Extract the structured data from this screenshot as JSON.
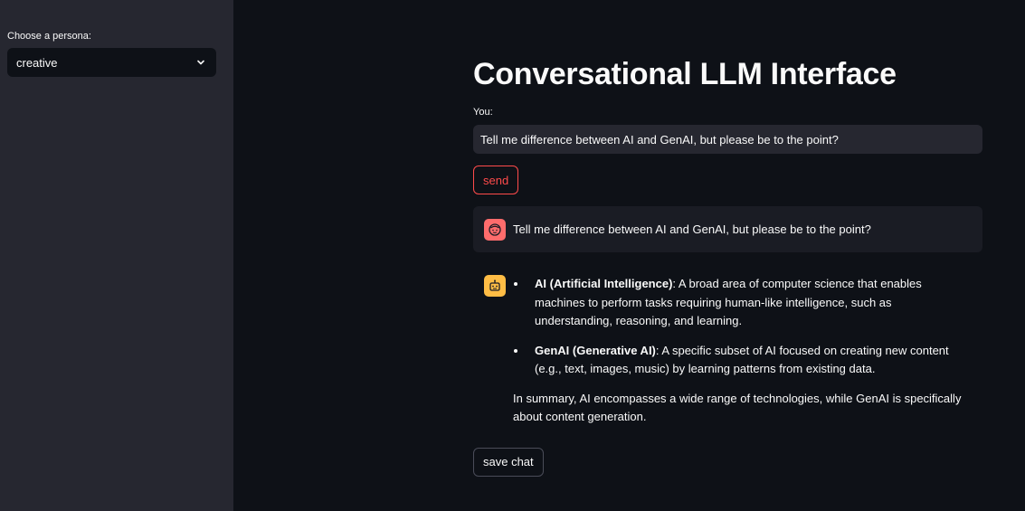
{
  "sidebar": {
    "persona_label": "Choose a persona:",
    "persona_selected": "creative"
  },
  "main": {
    "title": "Conversational LLM Interface",
    "input_label": "You:",
    "input_value": "Tell me difference between AI and GenAI, but please be to the point?",
    "send_label": "send",
    "save_label": "save chat"
  },
  "chat": {
    "user_message": "Tell me difference between AI and GenAI, but please be to the point?",
    "bot": {
      "bullets": [
        {
          "term": "AI (Artificial Intelligence)",
          "text": ": A broad area of computer science that enables machines to perform tasks requiring human-like intelligence, such as understanding, reasoning, and learning."
        },
        {
          "term": "GenAI (Generative AI)",
          "text": ": A specific subset of AI focused on creating new content (e.g., text, images, music) by learning patterns from existing data."
        }
      ],
      "summary": "In summary, AI encompasses a wide range of technologies, while GenAI is specifically about content generation."
    }
  },
  "colors": {
    "accent": "#ff4b4b",
    "sidebar_bg": "#262730",
    "main_bg": "#0e1117",
    "user_avatar": "#ff6c6c",
    "bot_avatar": "#ffbd45"
  },
  "icons": {
    "select_chevron": "chevron-down-icon",
    "user_avatar": "user-face-icon",
    "bot_avatar": "robot-icon"
  }
}
